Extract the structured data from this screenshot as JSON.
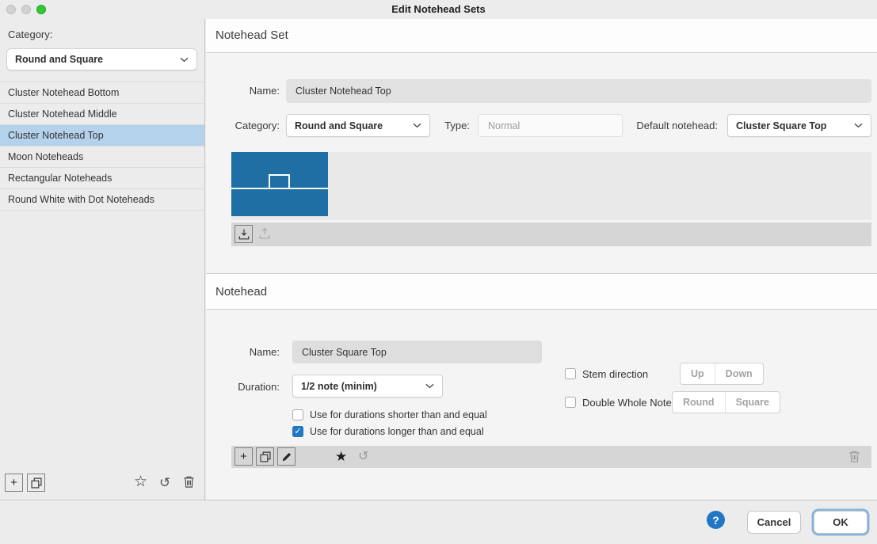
{
  "window": {
    "title": "Edit Notehead Sets"
  },
  "sidebar": {
    "category_label": "Category:",
    "category_value": "Round and Square",
    "items": [
      {
        "label": "Cluster Notehead Bottom"
      },
      {
        "label": "Cluster Notehead Middle"
      },
      {
        "label": "Cluster Notehead Top"
      },
      {
        "label": "Moon Noteheads"
      },
      {
        "label": "Rectangular Noteheads"
      },
      {
        "label": "Round White with Dot Noteheads"
      }
    ],
    "selected_index": 2
  },
  "notehead_set": {
    "section_title": "Notehead Set",
    "name_label": "Name:",
    "name_value": "Cluster Notehead Top",
    "category_label": "Category:",
    "category_value": "Round and Square",
    "type_label": "Type:",
    "type_value": "Normal",
    "default_notehead_label": "Default notehead:",
    "default_notehead_value": "Cluster Square Top"
  },
  "notehead": {
    "section_title": "Notehead",
    "name_label": "Name:",
    "name_value": "Cluster Square Top",
    "duration_label": "Duration:",
    "duration_value": "1/2 note (minim)",
    "use_shorter_label": "Use for durations shorter than and equal",
    "use_shorter_checked": false,
    "use_longer_label": "Use for durations longer than and equal",
    "use_longer_checked": true,
    "stem_direction_label": "Stem direction",
    "stem_direction_checked": false,
    "stem_up_label": "Up",
    "stem_down_label": "Down",
    "double_whole_label": "Double Whole Note",
    "double_whole_checked": false,
    "double_whole_round_label": "Round",
    "double_whole_square_label": "Square"
  },
  "footer": {
    "help_label": "?",
    "cancel_label": "Cancel",
    "ok_label": "OK"
  },
  "icons": {
    "plus": "+",
    "star_filled": "★",
    "star_outline": "☆",
    "reset": "↺",
    "check": "✓"
  },
  "colors": {
    "accent_blue": "#1f6fa5",
    "selection_blue": "#b4d2ec",
    "checkbox_blue": "#2277c4",
    "help_blue": "#2176c7"
  }
}
